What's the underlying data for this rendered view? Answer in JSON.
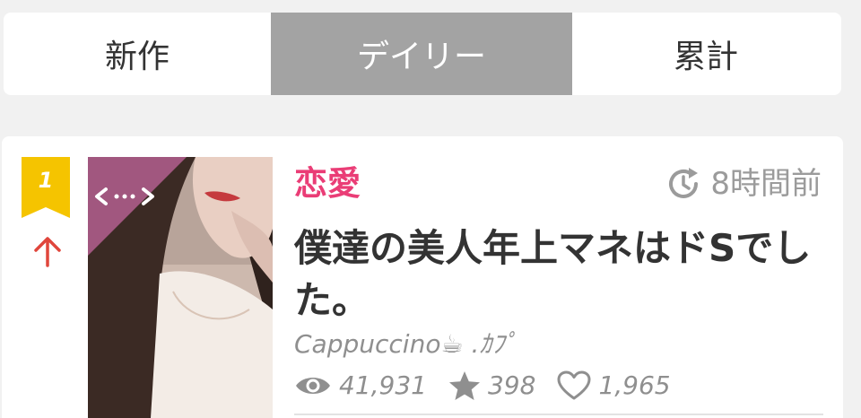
{
  "tabs": [
    {
      "label": "新作",
      "active": false
    },
    {
      "label": "デイリー",
      "active": true
    },
    {
      "label": "累計",
      "active": false
    }
  ],
  "ranking": {
    "rank": "1",
    "trend": "up"
  },
  "story": {
    "genre": "恋愛",
    "time_ago": "8時間前",
    "title": "僕達の美人年上マネはドSでした。",
    "author": "Cappuccino☕ .ｶﾌﾟ",
    "views": "41,931",
    "stars": "398",
    "likes": "1,965"
  },
  "colors": {
    "accent_pink": "#ea3d76",
    "rank_gold": "#f5c400",
    "trend_red": "#e0463c",
    "tab_active_bg": "#a3a3a3"
  },
  "icons": {
    "time": "clock-refresh-icon",
    "views": "eye-icon",
    "stars": "star-icon",
    "likes": "heart-icon",
    "trend": "arrow-up-icon",
    "corner": "horizontal-scroll-icon"
  }
}
